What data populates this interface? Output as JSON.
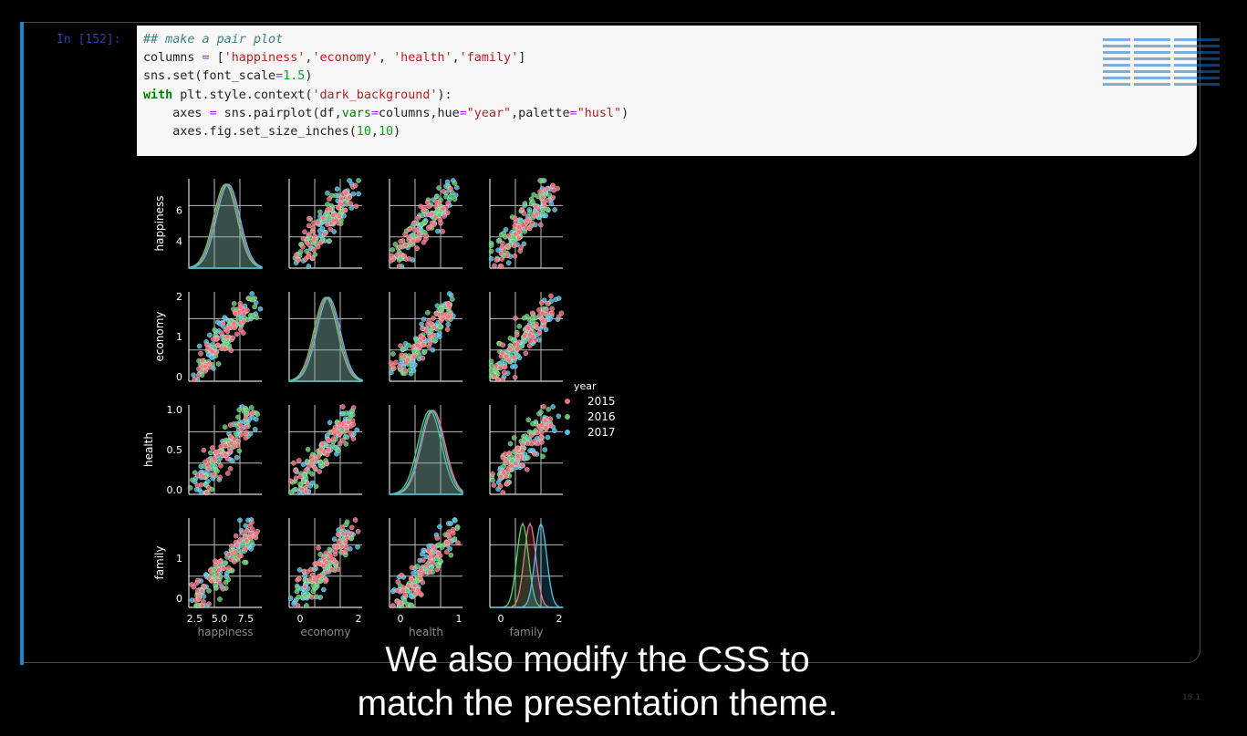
{
  "notebook": {
    "prompt": "In [152]:",
    "code_lines": [
      [
        {
          "t": "## make a pair plot",
          "c": "cm"
        }
      ],
      [
        {
          "t": "columns "
        },
        {
          "t": "=",
          "c": "op"
        },
        {
          "t": " ["
        },
        {
          "t": "'happiness'",
          "c": "st"
        },
        {
          "t": ","
        },
        {
          "t": "'economy'",
          "c": "st"
        },
        {
          "t": ", "
        },
        {
          "t": "'health'",
          "c": "st"
        },
        {
          "t": ","
        },
        {
          "t": "'family'",
          "c": "st"
        },
        {
          "t": "]"
        }
      ],
      [
        {
          "t": "sns.set(font_scale"
        },
        {
          "t": "=",
          "c": "op"
        },
        {
          "t": "1.5",
          "c": "nu"
        },
        {
          "t": ")"
        }
      ],
      [
        {
          "t": "with",
          "c": "kw"
        },
        {
          "t": " plt.style.context("
        },
        {
          "t": "'dark_background'",
          "c": "st"
        },
        {
          "t": "):"
        }
      ],
      [
        {
          "t": "    axes "
        },
        {
          "t": "=",
          "c": "op"
        },
        {
          "t": " sns.pairplot(df,"
        },
        {
          "t": "vars",
          "c": "kv"
        },
        {
          "t": "=",
          "c": "op"
        },
        {
          "t": "columns,hue"
        },
        {
          "t": "=",
          "c": "op"
        },
        {
          "t": "\"year\"",
          "c": "st"
        },
        {
          "t": ",palette"
        },
        {
          "t": "=",
          "c": "op"
        },
        {
          "t": "\"husl\"",
          "c": "st"
        },
        {
          "t": ")"
        }
      ],
      [
        {
          "t": "    axes.fig.set_size_inches("
        },
        {
          "t": "10",
          "c": "nu"
        },
        {
          "t": ","
        },
        {
          "t": "10",
          "c": "nu"
        },
        {
          "t": ")"
        }
      ]
    ]
  },
  "chart_data": {
    "type": "scatter",
    "variables": [
      "happiness",
      "economy",
      "health",
      "family"
    ],
    "ranges": {
      "happiness": [
        2.5,
        7.8
      ],
      "economy": [
        0,
        2
      ],
      "health": [
        0,
        1.05
      ],
      "family": [
        0,
        1.7
      ]
    },
    "ticks": {
      "happiness": {
        "y": [
          4,
          6
        ],
        "x": [
          "2.5",
          "5.0",
          "7.5"
        ]
      },
      "economy": {
        "y": [
          0,
          1,
          2
        ],
        "x": [
          "0",
          "2"
        ]
      },
      "health": {
        "y": [
          "0.0",
          "0.5",
          "1.0"
        ],
        "x": [
          "0",
          "1"
        ]
      },
      "family": {
        "y": [
          0,
          1
        ],
        "x": [
          "0",
          "2"
        ]
      }
    },
    "legend": {
      "title": "year",
      "placement": "right"
    },
    "series": [
      {
        "name": "2015",
        "color": "#f7707f"
      },
      {
        "name": "2016",
        "color": "#5fcc6a"
      },
      {
        "name": "2017",
        "color": "#4fc1e8"
      }
    ],
    "background": "dark_background"
  },
  "caption": {
    "line1": "We also modify the CSS to",
    "line2": "match the presentation theme."
  },
  "slide_number": "18.1",
  "colors": {
    "cell_bar": "#1e88c8",
    "logo": "#1f70c1"
  }
}
